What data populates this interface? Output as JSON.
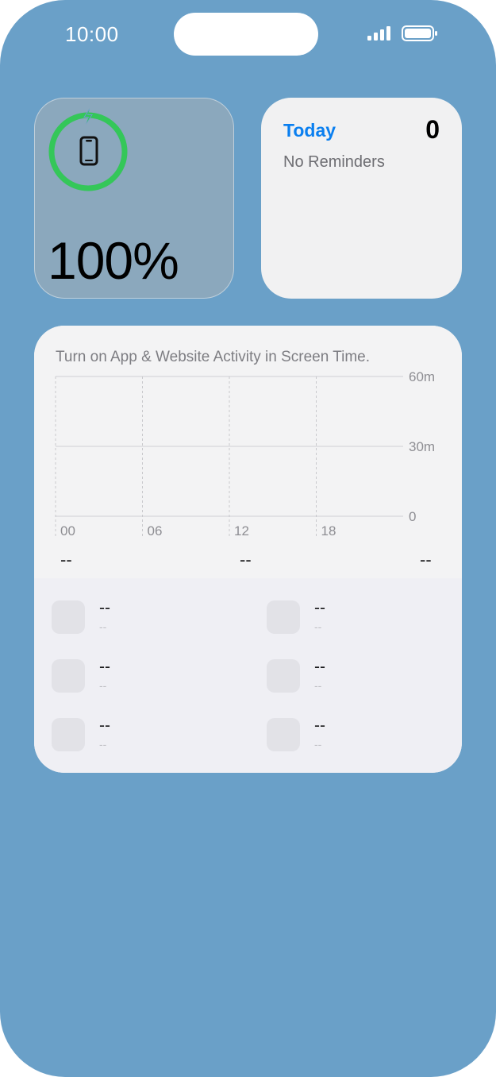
{
  "status_bar": {
    "time": "10:00"
  },
  "battery_widget": {
    "percent": "100%",
    "charge_level": 1.0,
    "ring_color": "#34c759"
  },
  "reminders_widget": {
    "title": "Today",
    "count": "0",
    "empty_text": "No Reminders",
    "accent": "#0a7ff0"
  },
  "screen_time_widget": {
    "message": "Turn on App & Website Activity in Screen Time.",
    "totals": [
      "--",
      "--",
      "--"
    ],
    "apps": [
      {
        "name": "--",
        "time": "--"
      },
      {
        "name": "--",
        "time": "--"
      },
      {
        "name": "--",
        "time": "--"
      },
      {
        "name": "--",
        "time": "--"
      },
      {
        "name": "--",
        "time": "--"
      },
      {
        "name": "--",
        "time": "--"
      }
    ]
  },
  "chart_data": {
    "type": "bar",
    "categories": [
      "00",
      "06",
      "12",
      "18"
    ],
    "y_ticks": [
      "60m",
      "30m",
      "0"
    ],
    "ylim": [
      0,
      60
    ],
    "values": [],
    "grid": true
  }
}
